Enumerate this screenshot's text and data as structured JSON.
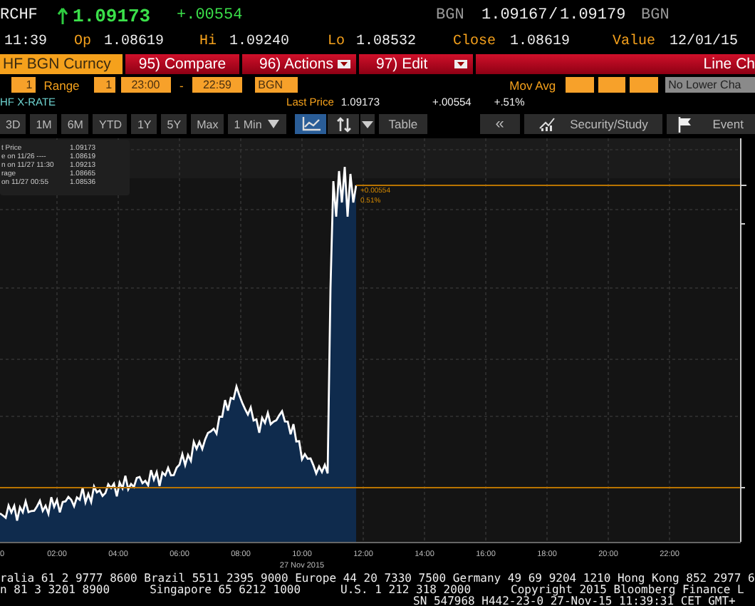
{
  "quote": {
    "ticker": "RCHF",
    "last": "1.09173",
    "change": "+.00554",
    "bid_source": "BGN",
    "bid": "1.09167",
    "separator": "/",
    "ask": "1.09179",
    "ask_source": "BGN"
  },
  "stats_time": "11:39",
  "stats": [
    {
      "label": "Op",
      "value": "1.08619"
    },
    {
      "label": "Hi",
      "value": "1.09240"
    },
    {
      "label": "Lo",
      "value": "1.08532"
    },
    {
      "label": "Close",
      "value": "1.08619"
    },
    {
      "label": "Value",
      "value": "12/01/15"
    }
  ],
  "function_bar": {
    "security": "HF BGN Curncy",
    "menus": [
      {
        "label": "95) Compare",
        "dropdown": false
      },
      {
        "label": "96) Actions",
        "dropdown": true
      },
      {
        "label": "97) Edit",
        "dropdown": true
      }
    ],
    "chart_type": "Line Ch"
  },
  "range_bar": {
    "period": "1",
    "range_label": "Range",
    "range_value": "1",
    "start": "23:00",
    "dash": "-",
    "end": "22:59",
    "source": "BGN",
    "mov_avg_label": "Mov Avg",
    "lower_chart": "No Lower Cha"
  },
  "title_row": {
    "title": "HF X-RATE",
    "last_price_label": "Last Price",
    "last_price": "1.09173",
    "change": "+.00554",
    "pct_change": "+.51%"
  },
  "toolbar": {
    "periods": [
      "3D",
      "1M",
      "6M",
      "YTD",
      "1Y",
      "5Y",
      "Max"
    ],
    "interval": "1 Min",
    "tools": [
      {
        "kind": "line",
        "selected": true
      },
      {
        "kind": "compare",
        "selected": false
      }
    ],
    "table": "Table",
    "collapse": "«",
    "security_study": "Security/Study",
    "event": "Event"
  },
  "chart": {
    "legend": [
      {
        "label": "t Price",
        "value": "1.09173"
      },
      {
        "label": "e on 11/26 ----",
        "value": "1.08619"
      },
      {
        "label": "n on 11/27 11:30",
        "value": "1.09213"
      },
      {
        "label": "rage",
        "value": "1.08665"
      },
      {
        "label": "on 11/27 00:55",
        "value": "1.08536"
      }
    ],
    "change_label": "+0.00554",
    "pct_label": "0.51%",
    "x_labels": [
      "0",
      "02:00",
      "04:00",
      "06:00",
      "08:00",
      "10:00",
      "12:00",
      "14:00",
      "16:00",
      "18:00",
      "20:00",
      "22:00"
    ],
    "date_label": "27 Nov 2015"
  },
  "footer": [
    [
      "ralia 61 2 9777 8600 Brazil 5511 2395 9000 Europe 44 20 7330 7500 Germany 49 69 9204 1210 Hong Kong 852 2977 6"
    ],
    [
      "n 81 3 3201 8900",
      "Singapore 65 6212 1000",
      "U.S. 1 212 318 2000",
      "Copyright 2015 Bloomberg Finance L"
    ],
    [
      "SN 547968 H442-23-0 27-Nov-15 11:39:31 CET  GMT+"
    ]
  ]
}
